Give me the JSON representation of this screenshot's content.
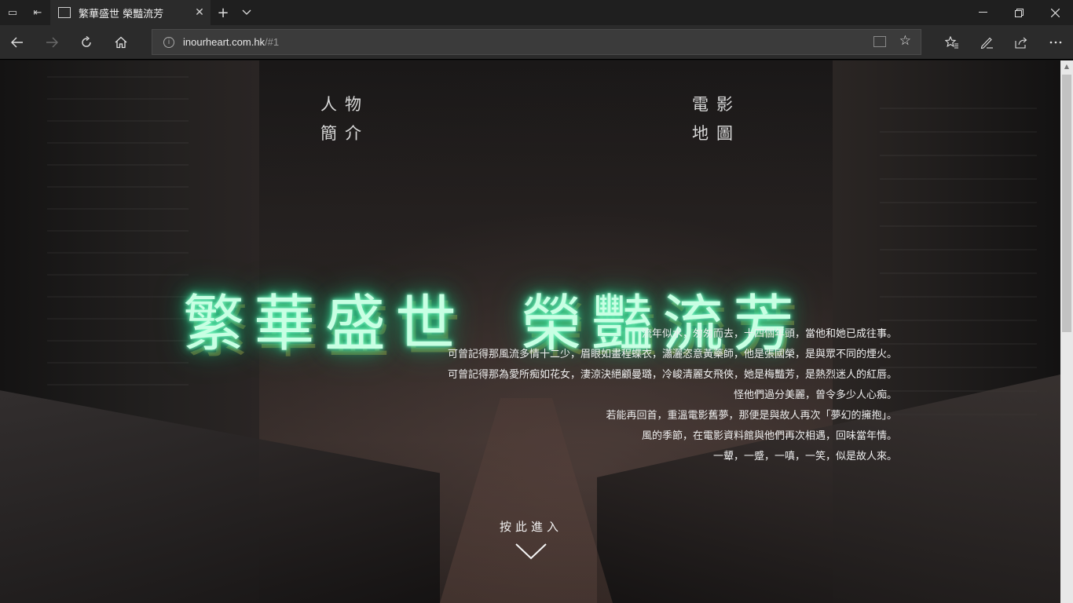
{
  "browser": {
    "tab_title": "繁華盛世 榮豔流芳",
    "url_host": "inourheart.com.hk",
    "url_path": "/#1",
    "new_tab_symbol": "+",
    "close_symbol": "✕"
  },
  "nav": {
    "profile_link": [
      "人物",
      "簡介"
    ],
    "map_link": [
      "電影",
      "地圖"
    ]
  },
  "hero": {
    "title_part1": "繁華盛世",
    "title_part2": "榮豔流芳",
    "neon_color": "#3fe8a0"
  },
  "poem": {
    "lines": [
      "流年似水，匆匆而去，十四個年頭，當他和她已成往事。",
      "可曾記得那風流多情十二少，眉眼如畫程蝶衣，瀟灑恣意黃藥師，他是張國榮，是與眾不同的煙火。",
      "可曾記得那為愛所痴如花女，淒涼決絕顧曼璐，冷峻清麗女飛俠，她是梅豔芳，是熱烈迷人的紅唇。",
      "怪他們過分美麗，曾令多少人心痴。",
      "若能再回首，重溫電影舊夢，那便是與故人再次「夢幻的擁抱」。",
      "風的季節，在電影資料館與他們再次相遇，回味當年情。",
      "一顰，一蹙，一嗔，一笑，似是故人來。"
    ]
  },
  "enter": {
    "label": "按此進入"
  },
  "icons": {
    "back": "arrow-left-icon",
    "forward": "arrow-right-icon",
    "refresh": "refresh-icon",
    "home": "home-icon",
    "favorites": "favorites-icon",
    "notes": "pen-icon",
    "share": "share-icon",
    "more": "more-icon"
  }
}
